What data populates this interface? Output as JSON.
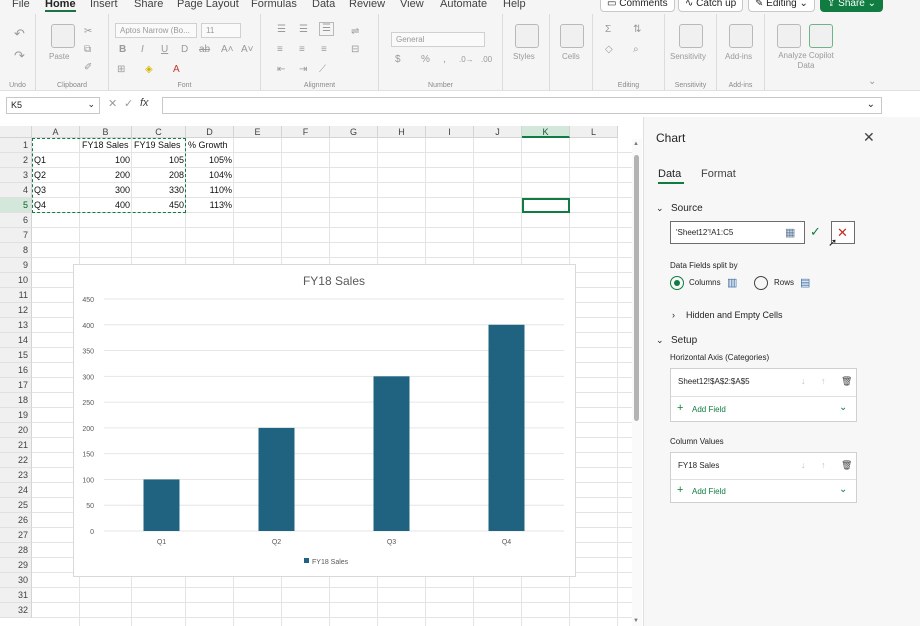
{
  "menu": {
    "items": [
      "File",
      "Home",
      "Insert",
      "Share",
      "Page Layout",
      "Formulas",
      "Data",
      "Review",
      "View",
      "Automate",
      "Help"
    ],
    "comments": "Comments",
    "catchup": "Catch up",
    "editing": "Editing",
    "share": "Share"
  },
  "ribbon": {
    "groups": {
      "undo": "Undo",
      "clipboard": "Clipboard",
      "font": "Font",
      "alignment": "Alignment",
      "number": "Number",
      "editing": "Editing",
      "sensitivity": "Sensitivity",
      "addins": "Add-ins"
    },
    "paste": "Paste",
    "font_name": "Aptos Narrow (Bo...",
    "font_size": "11",
    "number_format": "General",
    "styles": "Styles",
    "cells": "Cells",
    "sensitivity": "Sensitivity",
    "addins": "Add-ins",
    "analyze": "Analyze Copilot Data"
  },
  "formula_bar": {
    "name_box": "K5",
    "fx": "fx",
    "value": ""
  },
  "sheet": {
    "columns": [
      "A",
      "B",
      "C",
      "D",
      "E",
      "F",
      "G",
      "H",
      "I",
      "J",
      "K",
      "L"
    ],
    "selected_column": "K",
    "selected_row": 5,
    "rows": 32,
    "cells": {
      "header": [
        "",
        "FY18 Sales",
        "FY19 Sales",
        "% Growth"
      ],
      "data": [
        [
          "Q1",
          "100",
          "105",
          "105%"
        ],
        [
          "Q2",
          "200",
          "208",
          "104%"
        ],
        [
          "Q3",
          "300",
          "330",
          "110%"
        ],
        [
          "Q4",
          "400",
          "450",
          "113%"
        ]
      ]
    }
  },
  "chart_data": {
    "type": "bar",
    "title": "FY18 Sales",
    "categories": [
      "Q1",
      "Q2",
      "Q3",
      "Q4"
    ],
    "series": [
      {
        "name": "FY18 Sales",
        "values": [
          100,
          200,
          300,
          400
        ]
      }
    ],
    "ylim": [
      0,
      450
    ],
    "yticks": [
      0,
      50,
      100,
      150,
      200,
      250,
      300,
      350,
      400,
      450
    ],
    "grid": true,
    "legend": "bottom",
    "bar_color": "#1f6380"
  },
  "panel": {
    "title": "Chart",
    "tabs": [
      "Data",
      "Format"
    ],
    "source_label": "Source",
    "source_value": "'Sheet12'!A1:C5",
    "split_label": "Data Fields split by",
    "columns_opt": "Columns",
    "rows_opt": "Rows",
    "hidden_cells": "Hidden and Empty Cells",
    "setup_label": "Setup",
    "haxis_label": "Horizontal Axis (Categories)",
    "haxis_value": "Sheet12!$A$2:$A$5",
    "add_field": "Add Field",
    "colvals_label": "Column Values",
    "colvals_value": "FY18 Sales"
  },
  "colors": {
    "accent": "#107c41",
    "bar": "#1f6380"
  }
}
